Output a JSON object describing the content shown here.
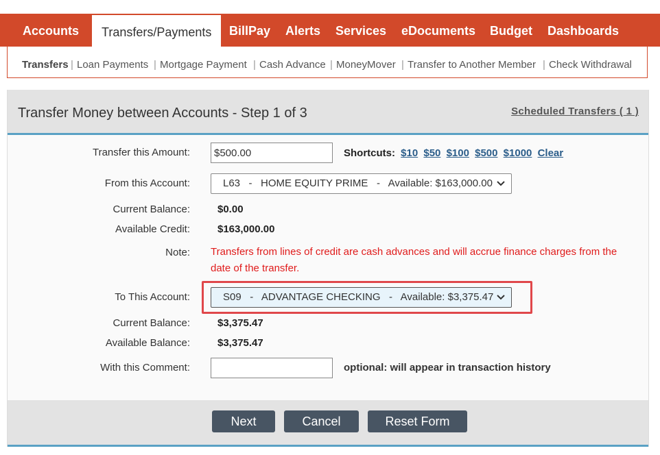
{
  "topnav": {
    "items": [
      {
        "label": "Accounts"
      },
      {
        "label": "Transfers/Payments",
        "active": true
      },
      {
        "label": "BillPay"
      },
      {
        "label": "Alerts"
      },
      {
        "label": "Services"
      },
      {
        "label": "eDocuments"
      },
      {
        "label": "Budget"
      },
      {
        "label": "Dashboards"
      }
    ]
  },
  "subnav": {
    "items": [
      {
        "label": "Transfers",
        "active": true
      },
      {
        "label": "Loan Payments"
      },
      {
        "label": "Mortgage Payment"
      },
      {
        "label": "Cash Advance"
      },
      {
        "label": "MoneyMover"
      },
      {
        "label": "Transfer to Another Member"
      },
      {
        "label": "Check Withdrawal"
      }
    ],
    "separator": "|"
  },
  "panel": {
    "title": "Transfer Money between Accounts - Step 1 of 3",
    "scheduled_link": "Scheduled Transfers ( 1 )"
  },
  "form": {
    "amount_label": "Transfer this Amount:",
    "amount_value": "$500.00",
    "shortcuts_label": "Shortcuts:",
    "shortcuts": [
      "$10",
      "$50",
      "$100",
      "$500",
      "$1000",
      "Clear"
    ],
    "from_label": "From this Account:",
    "from_selected": "L63   -   HOME EQUITY PRIME   -   Available: $163,000.00",
    "from_current_balance_label": "Current Balance:",
    "from_current_balance": "$0.00",
    "available_credit_label": "Available Credit:",
    "available_credit": "$163,000.00",
    "note_label": "Note:",
    "note_text": "Transfers from lines of credit are cash advances and will accrue finance charges from the date of the transfer.",
    "to_label": "To This Account:",
    "to_selected": "S09   -   ADVANTAGE CHECKING   -   Available: $3,375.47",
    "to_current_balance_label": "Current Balance:",
    "to_current_balance": "$3,375.47",
    "available_balance_label": "Available Balance:",
    "available_balance": "$3,375.47",
    "comment_label": "With this Comment:",
    "comment_value": "",
    "comment_hint": "optional: will appear in transaction history"
  },
  "buttons": {
    "next": "Next",
    "cancel": "Cancel",
    "reset": "Reset Form"
  },
  "icons": {
    "dropdown": "chevron-down-icon"
  },
  "colors": {
    "brand": "#d2492a",
    "accent_rule": "#5aa1c4",
    "note_red": "#e01b1b",
    "highlight": "#e0474a",
    "button": "#485563",
    "to_select_bg": "#e8f4fb"
  }
}
